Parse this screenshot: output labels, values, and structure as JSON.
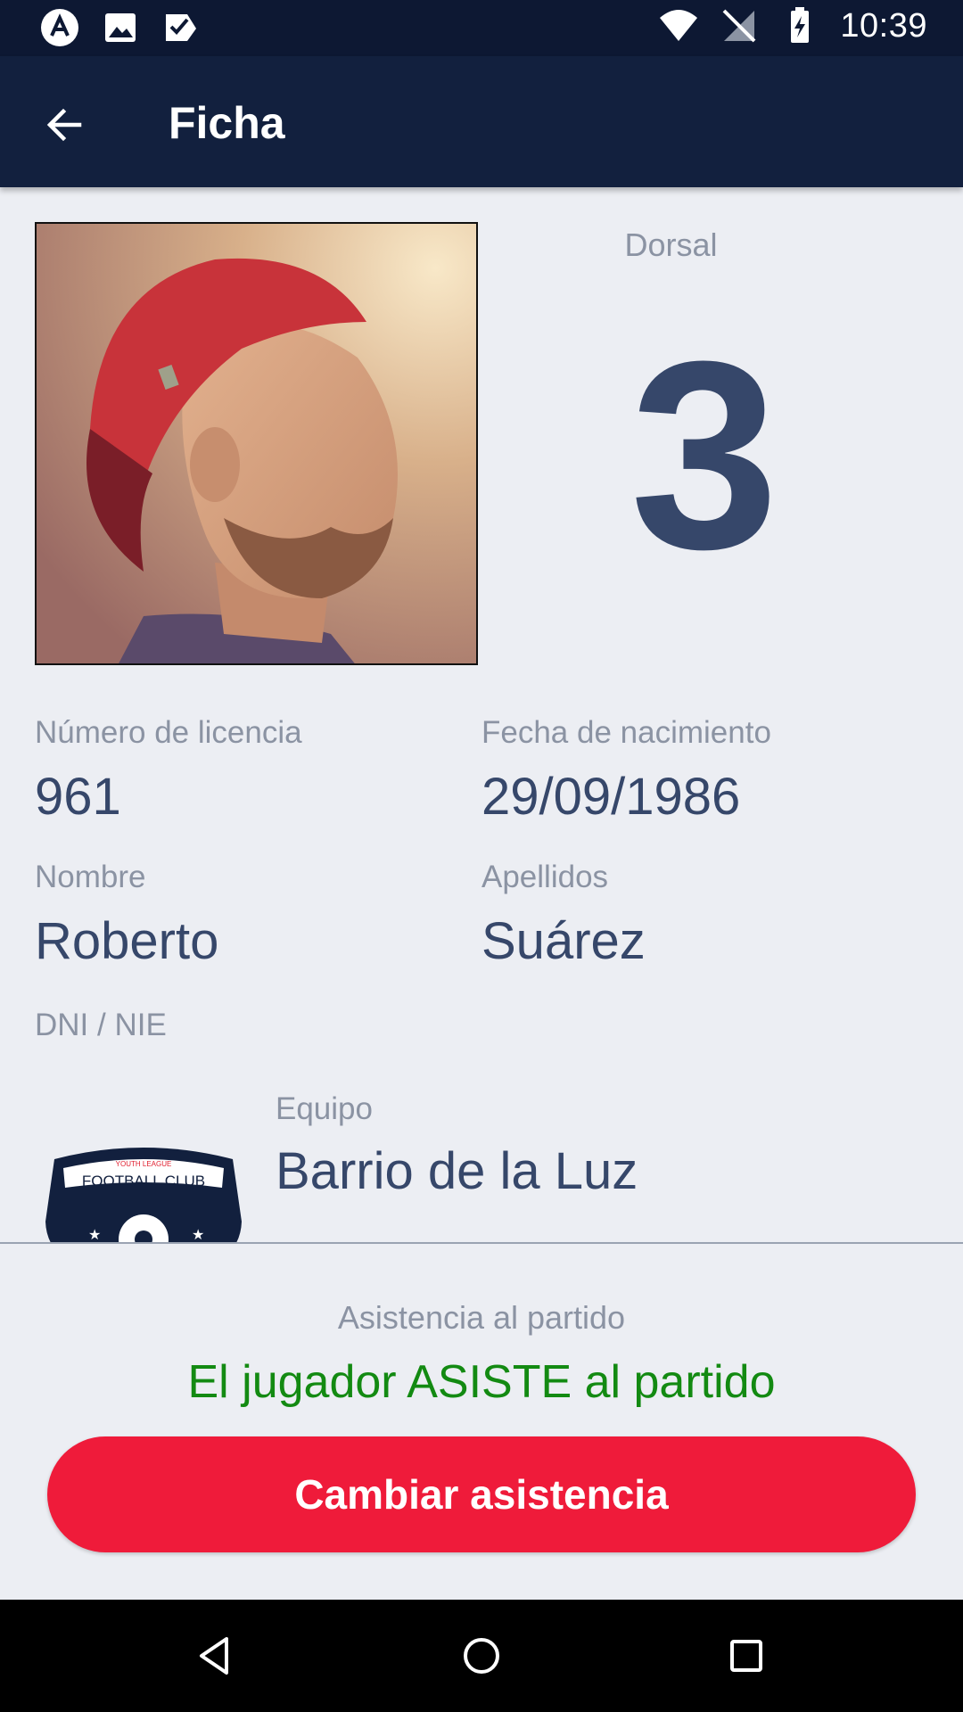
{
  "status_bar": {
    "time": "10:39",
    "left_icons": [
      "app-icon",
      "image-icon",
      "checklist-icon"
    ],
    "right_icons": [
      "wifi-icon",
      "no-signal-icon",
      "battery-charging-icon"
    ]
  },
  "app_bar": {
    "title": "Ficha",
    "back_icon": "arrow-back-icon"
  },
  "player": {
    "dorsal_label": "Dorsal",
    "dorsal_number": "3",
    "license_label": "Número de licencia",
    "license_value": "961",
    "birthdate_label": "Fecha de nacimiento",
    "birthdate_value": "29/09/1986",
    "name_label": "Nombre",
    "name_value": "Roberto",
    "surname_label": "Apellidos",
    "surname_value": "Suárez",
    "dni_label": "DNI / NIE",
    "team_label": "Equipo",
    "team_value": "Barrio de la Luz",
    "crest_top_text": "YOUTH LEAGUE",
    "crest_text": "FOOTBALL CLUB"
  },
  "attendance": {
    "label": "Asistencia al partido",
    "status": "El jugador ASISTE al partido",
    "button_label": "Cambiar asistencia"
  },
  "colors": {
    "status_bar": "#0d1833",
    "app_bar": "#12203e",
    "accent_value": "#36476a",
    "label_gray": "#8b93a3",
    "attend_green": "#138a12",
    "button_red": "#ef1b3a"
  },
  "nav_bar": {
    "icons": [
      "back-triangle-icon",
      "home-circle-icon",
      "recents-square-icon"
    ]
  }
}
